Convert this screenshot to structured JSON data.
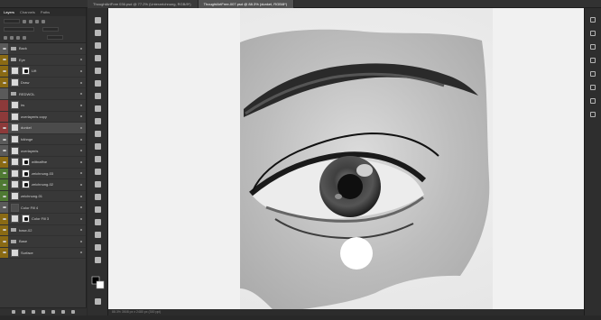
{
  "panel": {
    "tabs": [
      "Layers",
      "Channels",
      "Paths"
    ]
  },
  "layers": [
    {
      "name": "Back",
      "tag": "grey",
      "type": "folder",
      "eye": true
    },
    {
      "name": "Eye",
      "tag": "yellow",
      "type": "folder",
      "eye": true
    },
    {
      "name": "Lift",
      "tag": "yellow",
      "type": "mask",
      "eye": true
    },
    {
      "name": "Draw",
      "tag": "yellow",
      "type": "layer",
      "eye": true
    },
    {
      "name": "REDWOL",
      "tag": "grey",
      "type": "folder",
      "eye": false
    },
    {
      "name": "irs",
      "tag": "red",
      "type": "layer",
      "eye": false
    },
    {
      "name": "overlayeris copy",
      "tag": "red",
      "type": "layer",
      "eye": false
    },
    {
      "name": "dunkel",
      "tag": "red",
      "type": "layer",
      "eye": true,
      "selected": true
    },
    {
      "name": "hähnge",
      "tag": "grey",
      "type": "layer",
      "eye": true
    },
    {
      "name": "overlayeris",
      "tag": "grey",
      "type": "layer",
      "eye": true
    },
    {
      "name": "wittnaffne",
      "tag": "yellow",
      "type": "mask",
      "eye": true
    },
    {
      "name": "zeichnung-03",
      "tag": "green",
      "type": "mask",
      "eye": true
    },
    {
      "name": "zeichnung-02",
      "tag": "green",
      "type": "mask",
      "eye": true
    },
    {
      "name": "zeichnung-01",
      "tag": "green",
      "type": "layer",
      "eye": true
    },
    {
      "name": "Color Fill 4",
      "tag": "grey",
      "type": "dark",
      "eye": true
    },
    {
      "name": "Color Fill 3",
      "tag": "yellow",
      "type": "mask",
      "eye": true
    },
    {
      "name": "base-02",
      "tag": "yellow",
      "type": "folder",
      "eye": true
    },
    {
      "name": "Base",
      "tag": "yellow",
      "type": "folder",
      "eye": true
    },
    {
      "name": "Surface",
      "tag": "yellow",
      "type": "layer",
      "eye": true
    }
  ],
  "documents": {
    "tabs": [
      {
        "label": "ThoughtArtFree 036.psd @ 77.2% (Unterzeichnung, RGB/8*)",
        "active": false
      },
      {
        "label": "ThoughtArtFree-007.psd @ 88.3% (dunkel, RGB/8*)",
        "active": true
      }
    ]
  },
  "status": {
    "text": "88.3%    3508 px x 2480 px (300 ppi)"
  }
}
